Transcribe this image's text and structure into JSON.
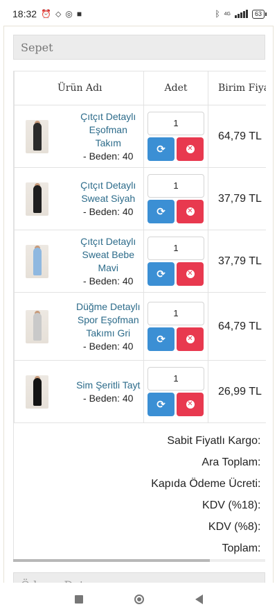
{
  "status_bar": {
    "time": "18:32",
    "battery": "63",
    "network": "4G"
  },
  "cart": {
    "title": "Sepet",
    "columns": {
      "image": "",
      "name": "Ürün Adı",
      "qty": "Adet",
      "unit_price": "Birim Fiyat"
    },
    "items": [
      {
        "name": "Çıtçıt Detaylı Eşofman Takım",
        "size": "- Beden: 40",
        "qty": "1",
        "price": "64,79 TL",
        "color": "#2b2b2b"
      },
      {
        "name": "Çıtçıt Detaylı Sweat Siyah",
        "size": "- Beden: 40",
        "qty": "1",
        "price": "37,79 TL",
        "color": "#1f1f1f"
      },
      {
        "name": "Çıtçıt Detaylı Sweat Bebe Mavi",
        "size": "- Beden: 40",
        "qty": "1",
        "price": "37,79 TL",
        "color": "#8fb8e0"
      },
      {
        "name": "Düğme Detaylı Spor Eşofman Takımı Gri",
        "size": "- Beden: 40",
        "qty": "1",
        "price": "64,79 TL",
        "color": "#c9c9c9"
      },
      {
        "name": "Sim Şeritli Tayt",
        "size": "- Beden: 40",
        "qty": "1",
        "price": "26,99 TL",
        "color": "#141414"
      }
    ],
    "summary": [
      "Sabit Fiyatlı Kargo:",
      "Ara Toplam:",
      "Kapıda Ödeme Ücreti:",
      "KDV (%18):",
      "KDV (%8):",
      "Toplam:"
    ],
    "scroll_position": 0.78
  },
  "next_panel": {
    "title": "Ödeme Detay"
  }
}
